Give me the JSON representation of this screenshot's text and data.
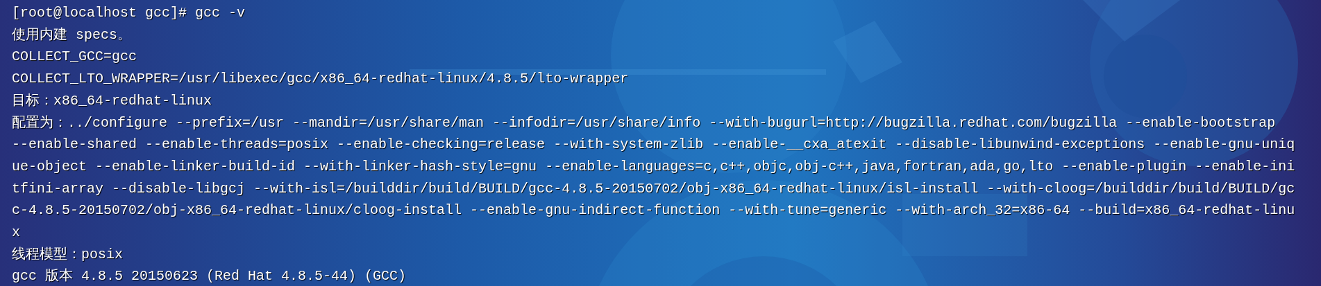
{
  "terminal": {
    "lines": [
      "[root@localhost gcc]# gcc -v",
      "使用内建 specs。",
      "COLLECT_GCC=gcc",
      "COLLECT_LTO_WRAPPER=/usr/libexec/gcc/x86_64-redhat-linux/4.8.5/lto-wrapper",
      "目标：x86_64-redhat-linux",
      "配置为：../configure --prefix=/usr --mandir=/usr/share/man --infodir=/usr/share/info --with-bugurl=http://bugzilla.redhat.com/bugzilla --enable-bootstrap",
      "--enable-shared --enable-threads=posix --enable-checking=release --with-system-zlib --enable-__cxa_atexit --disable-libunwind-exceptions --enable-gnu-uniq",
      "ue-object --enable-linker-build-id --with-linker-hash-style=gnu --enable-languages=c,c++,objc,obj-c++,java,fortran,ada,go,lto --enable-plugin --enable-ini",
      "tfini-array --disable-libgcj --with-isl=/builddir/build/BUILD/gcc-4.8.5-20150702/obj-x86_64-redhat-linux/isl-install --with-cloog=/builddir/build/BUILD/gc",
      "c-4.8.5-20150702/obj-x86_64-redhat-linux/cloog-install --enable-gnu-indirect-function --with-tune=generic --with-arch_32=x86-64 --build=x86_64-redhat-linu",
      "x",
      "线程模型：posix",
      "gcc 版本 4.8.5 20150623 (Red Hat 4.8.5-44) (GCC)"
    ]
  }
}
